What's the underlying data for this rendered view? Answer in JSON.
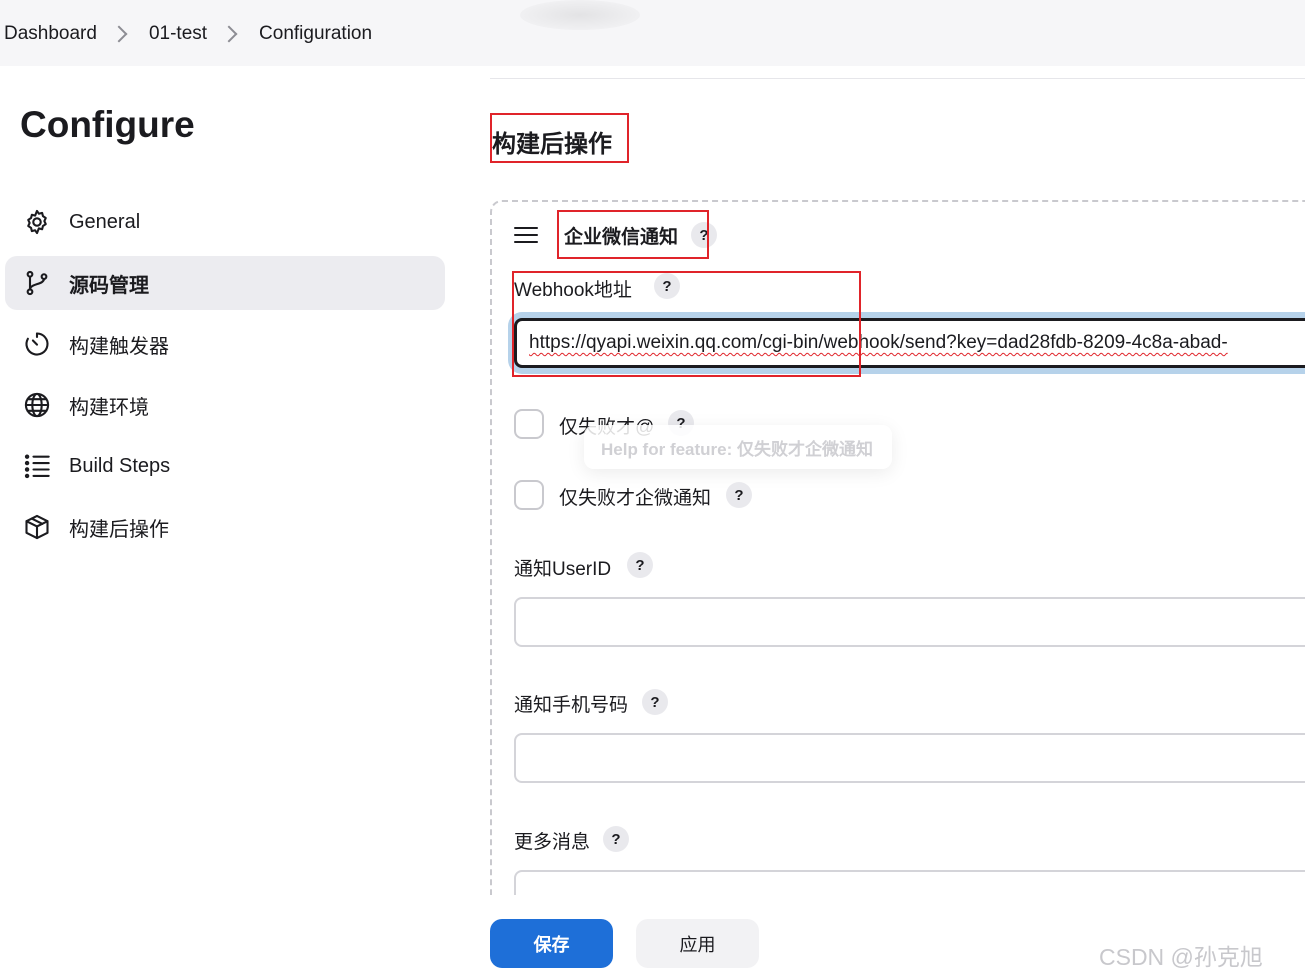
{
  "breadcrumb": [
    "Dashboard",
    "01-test",
    "Configuration"
  ],
  "page_title": "Configure",
  "sidebar": {
    "items": [
      {
        "label": "General",
        "icon": "gear-icon",
        "active": false
      },
      {
        "label": "源码管理",
        "icon": "branch-icon",
        "active": true
      },
      {
        "label": "构建触发器",
        "icon": "timer-icon",
        "active": false
      },
      {
        "label": "构建环境",
        "icon": "globe-icon",
        "active": false
      },
      {
        "label": "Build Steps",
        "icon": "list-icon",
        "active": false
      },
      {
        "label": "构建后操作",
        "icon": "package-icon",
        "active": false
      }
    ]
  },
  "main": {
    "section_title": "构建后操作",
    "card": {
      "title": "企业微信通知",
      "help": "?",
      "webhook": {
        "label": "Webhook地址",
        "value": "https://qyapi.weixin.qq.com/cgi-bin/webhook/send?key=dad28fdb-8209-4c8a-abad-"
      },
      "fail_at": {
        "label": "仅失败才@",
        "checked": false
      },
      "tooltip": "Help for feature: 仅失败才企微通知",
      "fail_notify": {
        "label": "仅失败才企微通知",
        "checked": false
      },
      "userid": {
        "label": "通知UserID",
        "value": ""
      },
      "phone": {
        "label": "通知手机号码",
        "value": ""
      },
      "more": {
        "label": "更多消息",
        "value": ""
      }
    }
  },
  "buttons": {
    "save": "保存",
    "apply": "应用"
  },
  "watermark": "CSDN @孙克旭",
  "colors": {
    "primary": "#1e6fd8",
    "highlight": "#e0242a",
    "focus_ring": "#b6d2ea"
  }
}
